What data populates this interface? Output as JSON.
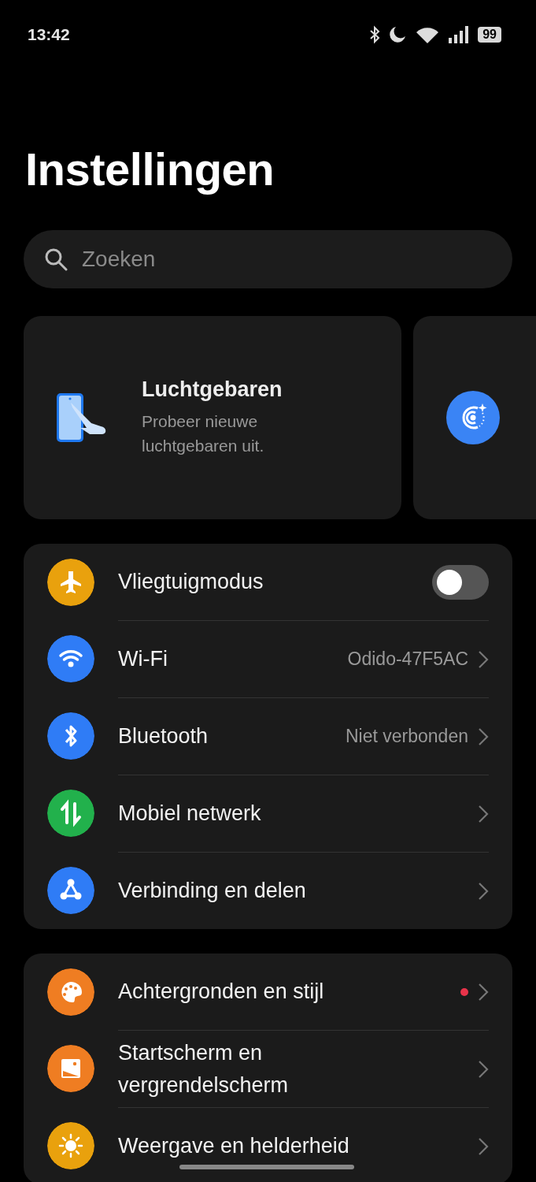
{
  "status_bar": {
    "time": "13:42",
    "battery": "99"
  },
  "title": "Instellingen",
  "search": {
    "placeholder": "Zoeken"
  },
  "cards": [
    {
      "title": "Luchtgebaren",
      "subtitle": "Probeer nieuwe luchtgebaren uit."
    },
    {
      "kind": "partial"
    }
  ],
  "groups": [
    {
      "items": [
        {
          "kind": "toggle",
          "label": "Vliegtuigmodus",
          "on": false,
          "color": "#e9a10d"
        },
        {
          "kind": "link",
          "label": "Wi-Fi",
          "value": "Odido-47F5AC",
          "color": "#2f7cf6"
        },
        {
          "kind": "link",
          "label": "Bluetooth",
          "value": "Niet verbonden",
          "color": "#2f7cf6"
        },
        {
          "kind": "link",
          "label": "Mobiel netwerk",
          "color": "#22b14c"
        },
        {
          "kind": "link",
          "label": "Verbinding en delen",
          "color": "#2f7cf6"
        }
      ]
    },
    {
      "items": [
        {
          "kind": "link",
          "label": "Achtergronden en stijl",
          "color": "#ef7d22",
          "dot": true
        },
        {
          "kind": "link",
          "label": "Startscherm en vergrendelscherm",
          "color": "#ef7d22",
          "dot": false
        },
        {
          "kind": "link",
          "label": "Weergave en helderheid",
          "color": "#e9a10d",
          "dot": false
        }
      ]
    }
  ]
}
